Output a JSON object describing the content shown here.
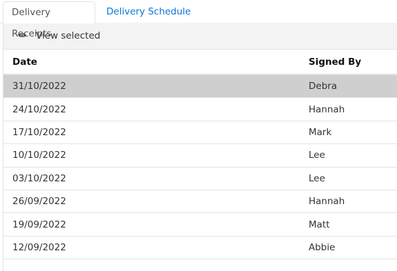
{
  "tabs": [
    {
      "label": "Delivery Receipts",
      "active": true
    },
    {
      "label": "Delivery Schedule",
      "active": false
    }
  ],
  "toolbar": {
    "view_selected_label": "View selected",
    "icon": "eye-icon"
  },
  "columns": {
    "date": "Date",
    "signed_by": "Signed By"
  },
  "rows": [
    {
      "date": "31/10/2022",
      "signed_by": "Debra",
      "selected": true
    },
    {
      "date": "24/10/2022",
      "signed_by": "Hannah"
    },
    {
      "date": "17/10/2022",
      "signed_by": "Mark"
    },
    {
      "date": "10/10/2022",
      "signed_by": "Lee"
    },
    {
      "date": "03/10/2022",
      "signed_by": "Lee"
    },
    {
      "date": "26/09/2022",
      "signed_by": "Hannah"
    },
    {
      "date": "19/09/2022",
      "signed_by": "Matt"
    },
    {
      "date": "12/09/2022",
      "signed_by": "Abbie"
    }
  ],
  "colors": {
    "link": "#0b76d8",
    "selected_row": "#cfcfcf",
    "toolbar_bg": "#f3f3f3"
  }
}
